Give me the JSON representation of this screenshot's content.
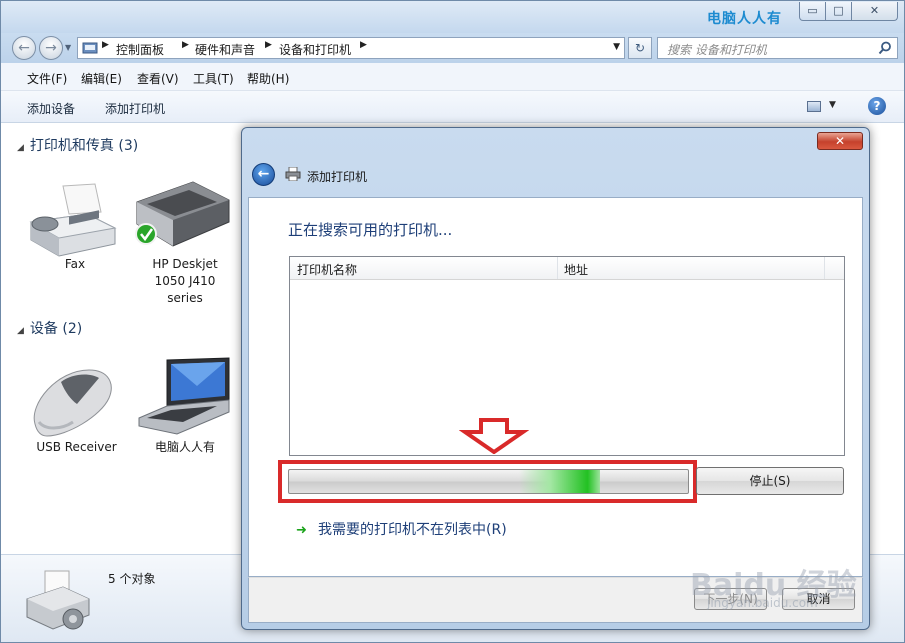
{
  "window": {
    "watermark_title": "电脑人人有",
    "min_label": "▭",
    "max_label": "□",
    "close_label": "✕"
  },
  "address": {
    "crumbs": [
      "控制面板",
      "硬件和声音",
      "设备和打印机"
    ],
    "search_placeholder": "搜索 设备和打印机"
  },
  "menu": [
    "文件(F)",
    "编辑(E)",
    "查看(V)",
    "工具(T)",
    "帮助(H)"
  ],
  "commands": [
    "添加设备",
    "添加打印机"
  ],
  "groups": {
    "printers": {
      "label": "打印机和传真 (3)"
    },
    "devices": {
      "label": "设备 (2)"
    }
  },
  "devices": {
    "fax": "Fax",
    "hp_line1": "HP Deskjet",
    "hp_line2": "1050 J410",
    "hp_line3": "series",
    "usb": "USB Receiver",
    "laptop": "电脑人人有"
  },
  "details": {
    "count": "5 个对象"
  },
  "dialog": {
    "title": "添加打印机",
    "close_label": "✕",
    "searching": "正在搜索可用的打印机...",
    "columns": [
      "打印机名称",
      "地址"
    ],
    "progress": 0.78,
    "stop": "停止(S)",
    "not_listed": "我需要的打印机不在列表中(R)",
    "next": "下一步(N)",
    "cancel": "取消"
  },
  "watermark": {
    "brand": "Baidu 经验",
    "url": "jingyan.baidu.com"
  },
  "colors": {
    "accent": "#1e3f78",
    "progress_green": "#22c122",
    "highlight_red": "#d92a2a"
  }
}
